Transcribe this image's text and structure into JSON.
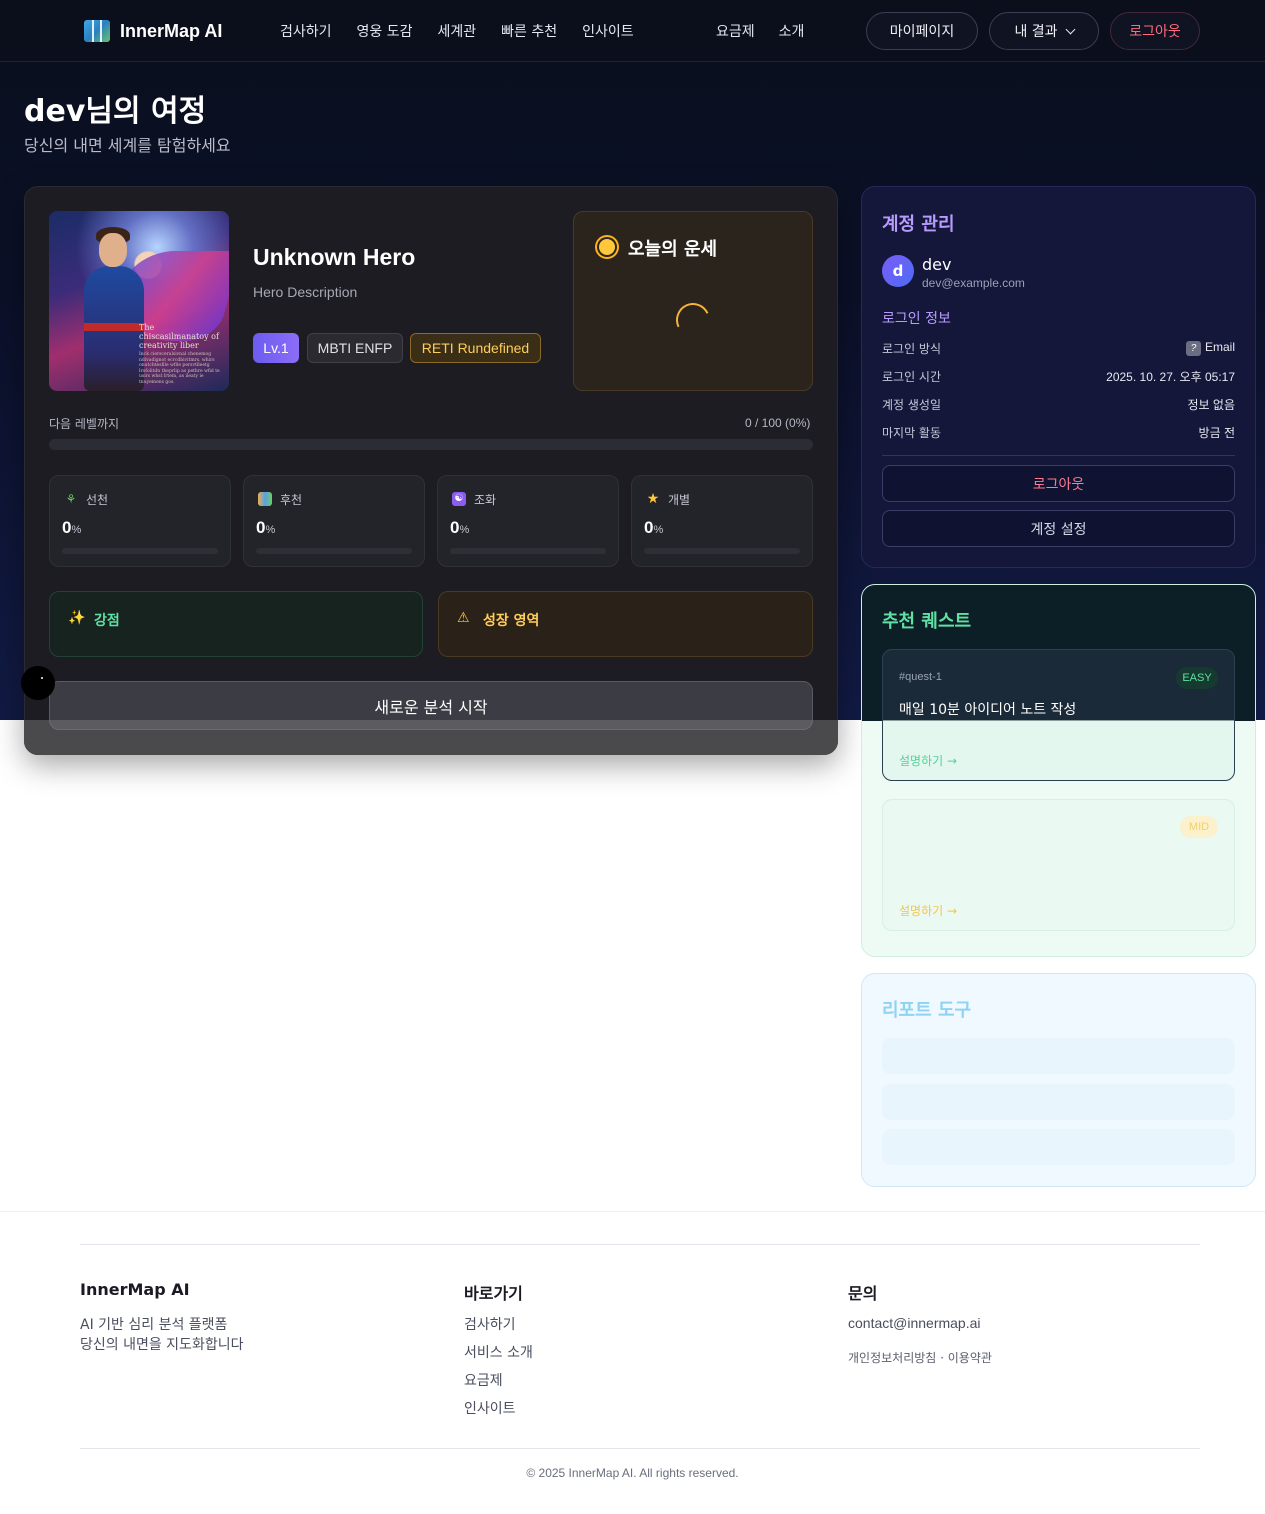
{
  "nav": {
    "brand": "InnerMap AI",
    "links": [
      "검사하기",
      "영웅 도감",
      "세계관",
      "빠른 추천",
      "인사이트"
    ],
    "links_right": [
      "요금제",
      "소개"
    ],
    "mypage": "마이페이지",
    "results": "내 결과",
    "logout": "로그아웃"
  },
  "header": {
    "title": "dev님의 여정",
    "subtitle": "당신의 내면 세계를 탐험하세요"
  },
  "hero": {
    "portrait_caption": "The chiscasilmanatoy of creativity liber",
    "portrait_fineprint": "Inck ciersceralsivnal chenemog ndivadignot ecrcdbivitmrs. whirs onutchtesfile wflle persvtlleetg lrofolitdn theprlip as pethre wfid te usirs whst lrtem, as ileaty ie tnuyemens gos.",
    "name": "Unknown Hero",
    "description": "Hero Description",
    "level_tag": "Lv.1",
    "mbti_tag": "MBTI ENFP",
    "reti_tag": "RETI Rundefined",
    "fortune_title": "오늘의 운세",
    "next_level_label": "다음 레벨까지",
    "next_level_value": "0 / 100 (0%)",
    "level_progress": 0
  },
  "stats": [
    {
      "label": "선천",
      "value": "0",
      "unit": "%",
      "icon": "sprout-icon",
      "progress": 0
    },
    {
      "label": "후천",
      "value": "0",
      "unit": "%",
      "icon": "books-icon",
      "progress": 0
    },
    {
      "label": "조화",
      "value": "0",
      "unit": "%",
      "icon": "yin-yang-icon",
      "progress": 0
    },
    {
      "label": "개별",
      "value": "0",
      "unit": "%",
      "icon": "star-icon",
      "progress": 0
    }
  ],
  "strength": {
    "title": "강점",
    "icon": "sparkles-icon"
  },
  "growth": {
    "title": "성장 영역",
    "icon": "warning-icon"
  },
  "cta": "새로운 분석 시작",
  "account": {
    "title": "계정 관리",
    "avatar_letter": "d",
    "name": "dev",
    "email": "dev@example.com",
    "login_info_title": "로그인 정보",
    "rows": [
      {
        "label": "로그인 방식",
        "value": "Email"
      },
      {
        "label": "로그인 시간",
        "value": "2025. 10. 27. 오후 05:17"
      },
      {
        "label": "계정 생성일",
        "value": "정보 없음"
      },
      {
        "label": "마지막 활동",
        "value": "방금 전"
      }
    ],
    "logout": "로그아웃",
    "settings": "계정 설정"
  },
  "quests": {
    "title": "추천 퀘스트",
    "items": [
      {
        "id": "#quest-1",
        "badge": "EASY",
        "name": "매일 10분 아이디어 노트 작성",
        "link": "설명하기 →"
      },
      {
        "id": "",
        "badge": "MID",
        "name": "",
        "link": "설명하기 →"
      }
    ]
  },
  "reports": {
    "title": "리포트 도구"
  },
  "footer": {
    "brand": "InnerMap AI",
    "tagline1": "AI 기반 심리 분석 플랫폼",
    "tagline2": "당신의 내면을 지도화합니다",
    "shortcuts_title": "바로가기",
    "shortcuts": [
      "검사하기",
      "서비스 소개",
      "요금제",
      "인사이트"
    ],
    "contact_title": "문의",
    "contact_email": "contact@innermap.ai",
    "legal": "개인정보처리방침 · 이용약관",
    "copyright": "© 2025 InnerMap AI. All rights reserved."
  }
}
